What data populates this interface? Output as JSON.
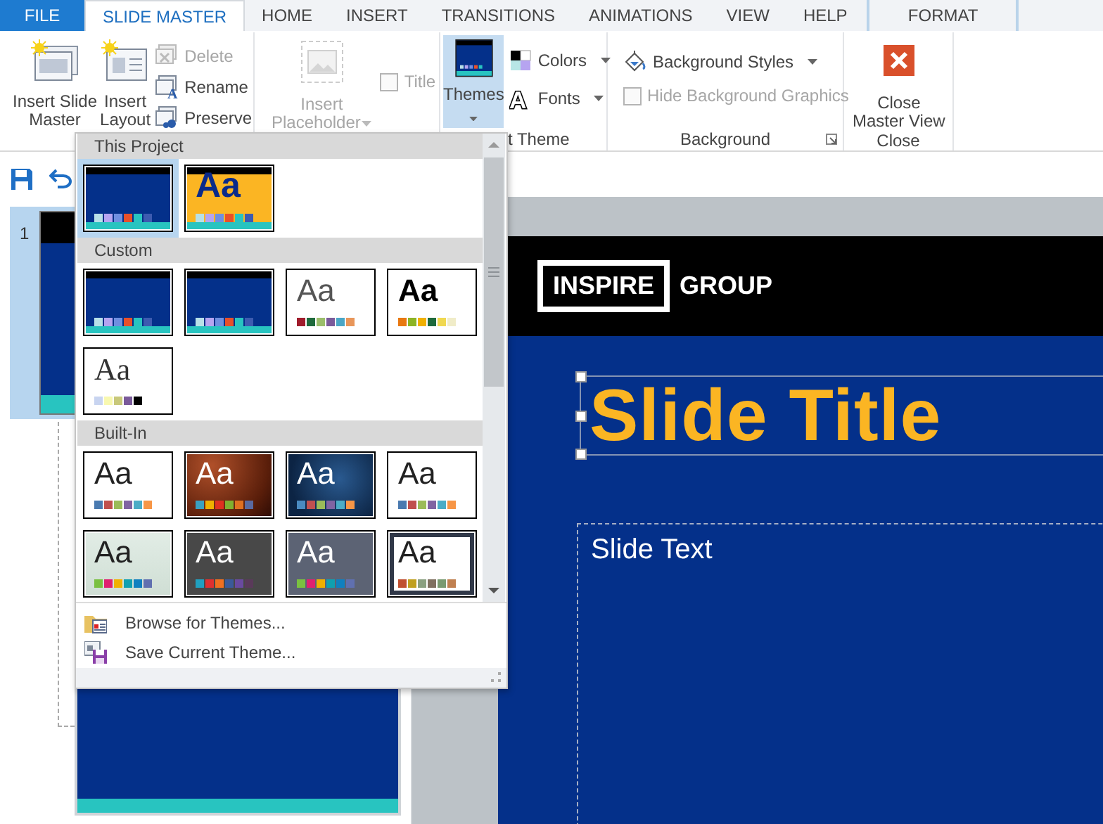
{
  "tabs": [
    {
      "label": "FILE",
      "kind": "file",
      "selected": false
    },
    {
      "label": "SLIDE MASTER",
      "kind": "normal",
      "selected": true
    },
    {
      "label": "HOME",
      "kind": "normal",
      "selected": false
    },
    {
      "label": "INSERT",
      "kind": "normal",
      "selected": false
    },
    {
      "label": "TRANSITIONS",
      "kind": "normal",
      "selected": false
    },
    {
      "label": "ANIMATIONS",
      "kind": "normal",
      "selected": false
    },
    {
      "label": "VIEW",
      "kind": "normal",
      "selected": false
    },
    {
      "label": "HELP",
      "kind": "normal",
      "selected": false
    },
    {
      "label": "FORMAT",
      "kind": "contextual",
      "selected": false
    }
  ],
  "ribbon": {
    "insert_slide_master": {
      "lines": [
        "Insert Slide",
        "Master"
      ]
    },
    "insert_layout": {
      "lines": [
        "Insert",
        "Layout"
      ]
    },
    "small_buttons": [
      {
        "label": "Delete",
        "kind": "delete",
        "disabled": true
      },
      {
        "label": "Rename",
        "kind": "rename",
        "glyph": "A",
        "disabled": false
      },
      {
        "label": "Preserve",
        "kind": "preserve",
        "disabled": false
      }
    ],
    "insert_placeholder": {
      "lines": [
        "Insert",
        "Placeholder"
      ],
      "disabled": true
    },
    "title_checkbox": {
      "label": "Title",
      "checked": false,
      "disabled": true
    },
    "themes": {
      "label": "Themes",
      "pressed": true
    },
    "theme_menus": [
      {
        "label": "Colors",
        "kind": "colors"
      },
      {
        "label": "Fonts",
        "kind": "fonts",
        "glyph": "A"
      }
    ],
    "edit_theme_group_label": "t Theme",
    "background_styles": {
      "label": "Background Styles"
    },
    "hide_background_graphics": {
      "label": "Hide Background Graphics",
      "checked": false,
      "disabled": true
    },
    "background_group_label": "Background",
    "close_master_view": {
      "lines": [
        "Close",
        "Master View"
      ]
    },
    "close_group_label": "Close"
  },
  "slide_pane": {
    "slides": [
      {
        "number": "1",
        "selected": true
      }
    ]
  },
  "slide": {
    "logo_boxed": "INSPIRE",
    "logo_text": "GROUP",
    "title": "Slide Title",
    "body": "Slide Text"
  },
  "themes_gallery": {
    "sections": [
      {
        "heading": "This Project",
        "items": [
          {
            "kind": "inspire",
            "selected": true
          },
          {
            "kind": "inspire-aa",
            "sample": "Aa",
            "selected": false
          }
        ]
      },
      {
        "heading": "Custom",
        "items": [
          {
            "kind": "inspire",
            "selected": false
          },
          {
            "kind": "inspire",
            "selected": false
          },
          {
            "kind": "white-sans",
            "sample": "Aa",
            "selected": false
          },
          {
            "kind": "white-bold",
            "sample": "Aa",
            "selected": false
          },
          {
            "kind": "white-serif",
            "sample": "Aa",
            "selected": false
          }
        ]
      },
      {
        "heading": "Built-In",
        "items": [
          {
            "kind": "office",
            "sample": "Aa",
            "selected": false
          },
          {
            "kind": "brown",
            "sample": "Aa",
            "selected": false
          },
          {
            "kind": "blue-dark",
            "sample": "Aa",
            "selected": false
          },
          {
            "kind": "office2",
            "sample": "Aa",
            "selected": false
          },
          {
            "kind": "light-green",
            "sample": "Aa",
            "selected": false
          },
          {
            "kind": "dark-gray",
            "sample": "Aa",
            "selected": false
          },
          {
            "kind": "slate",
            "sample": "Aa",
            "selected": false
          },
          {
            "kind": "framed",
            "sample": "Aa",
            "selected": false
          }
        ]
      }
    ],
    "commands": [
      {
        "label": "Browse for Themes...",
        "kind": "browse"
      },
      {
        "label": "Save Current Theme...",
        "kind": "save"
      }
    ]
  }
}
